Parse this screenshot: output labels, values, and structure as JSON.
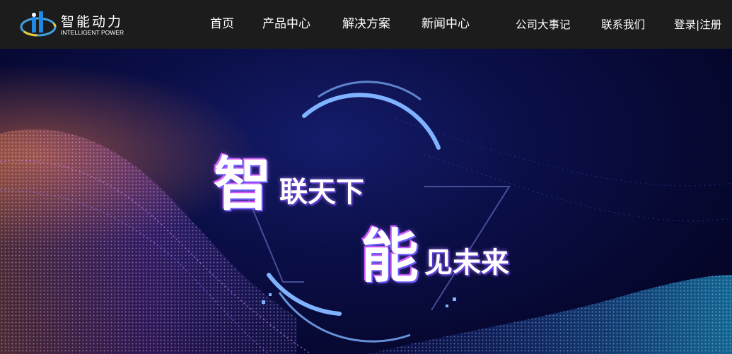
{
  "brand": {
    "name_cn": "智能动力",
    "name_en": "INTELLIGENT POWER"
  },
  "nav": {
    "home": "首页",
    "products": "产品中心",
    "solutions": "解决方案",
    "news": "新闻中心",
    "milestones": "公司大事记",
    "contact": "联系我们",
    "auth": "登录|注册"
  },
  "banner": {
    "line1_big": "智",
    "line1_rest": "联天下",
    "line2_big": "能",
    "line2_rest": "见未来"
  },
  "colors": {
    "header_bg": "#1c1c1c",
    "banner_bg": "#0b0f48",
    "accent_blue": "#7fb3ff",
    "accent_orange": "#e8784a"
  }
}
